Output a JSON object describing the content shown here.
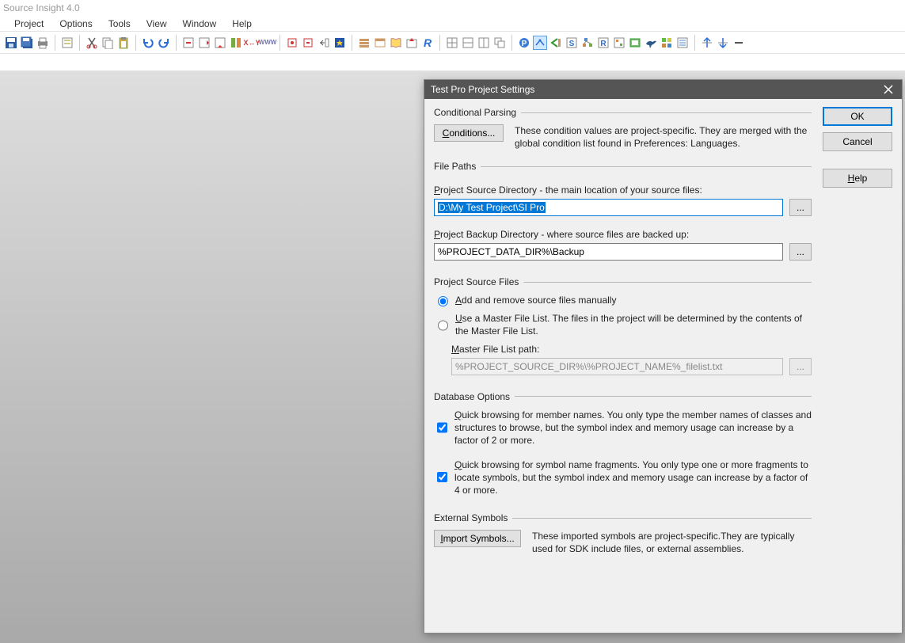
{
  "app": {
    "title": "Source Insight 4.0"
  },
  "menu": [
    "Project",
    "Options",
    "Tools",
    "View",
    "Window",
    "Help"
  ],
  "dialog": {
    "title": "Test Pro Project Settings",
    "buttons": {
      "ok": "OK",
      "cancel": "Cancel",
      "help": "Help"
    },
    "sections": {
      "conditional": {
        "legend": "Conditional Parsing",
        "button": "Conditions...",
        "desc": "These condition values are project-specific.  They are merged with the global condition list found in Preferences: Languages."
      },
      "filepaths": {
        "legend": "File Paths",
        "src_label": "Project Source Directory - the main location of your source files:",
        "src_value": "D:\\My Test Project\\SI Pro",
        "bak_label": "Project Backup Directory - where source files are backed up:",
        "bak_value": "%PROJECT_DATA_DIR%\\Backup",
        "browse": "..."
      },
      "srcfiles": {
        "legend": "Project Source Files",
        "opt_manual": "Add and remove source files manually",
        "opt_master": "Use a Master File List. The files in the project will be determined by the contents of the Master File List.",
        "master_label": "Master File List path:",
        "master_value": "%PROJECT_SOURCE_DIR%\\%PROJECT_NAME%_filelist.txt",
        "browse": "..."
      },
      "db": {
        "legend": "Database Options",
        "quick_members": "Quick browsing for member names.  You only type the member names of classes and structures to browse, but the symbol index and memory usage can increase by a factor of 2 or more.",
        "quick_fragments": "Quick browsing for symbol name fragments.  You only type one or more fragments to locate symbols, but the symbol index and memory usage can increase by a factor of 4 or more."
      },
      "ext": {
        "legend": "External Symbols",
        "button": "Import Symbols...",
        "desc": "These imported symbols are project-specific.They are typically used for SDK include files, or external assemblies."
      }
    }
  }
}
